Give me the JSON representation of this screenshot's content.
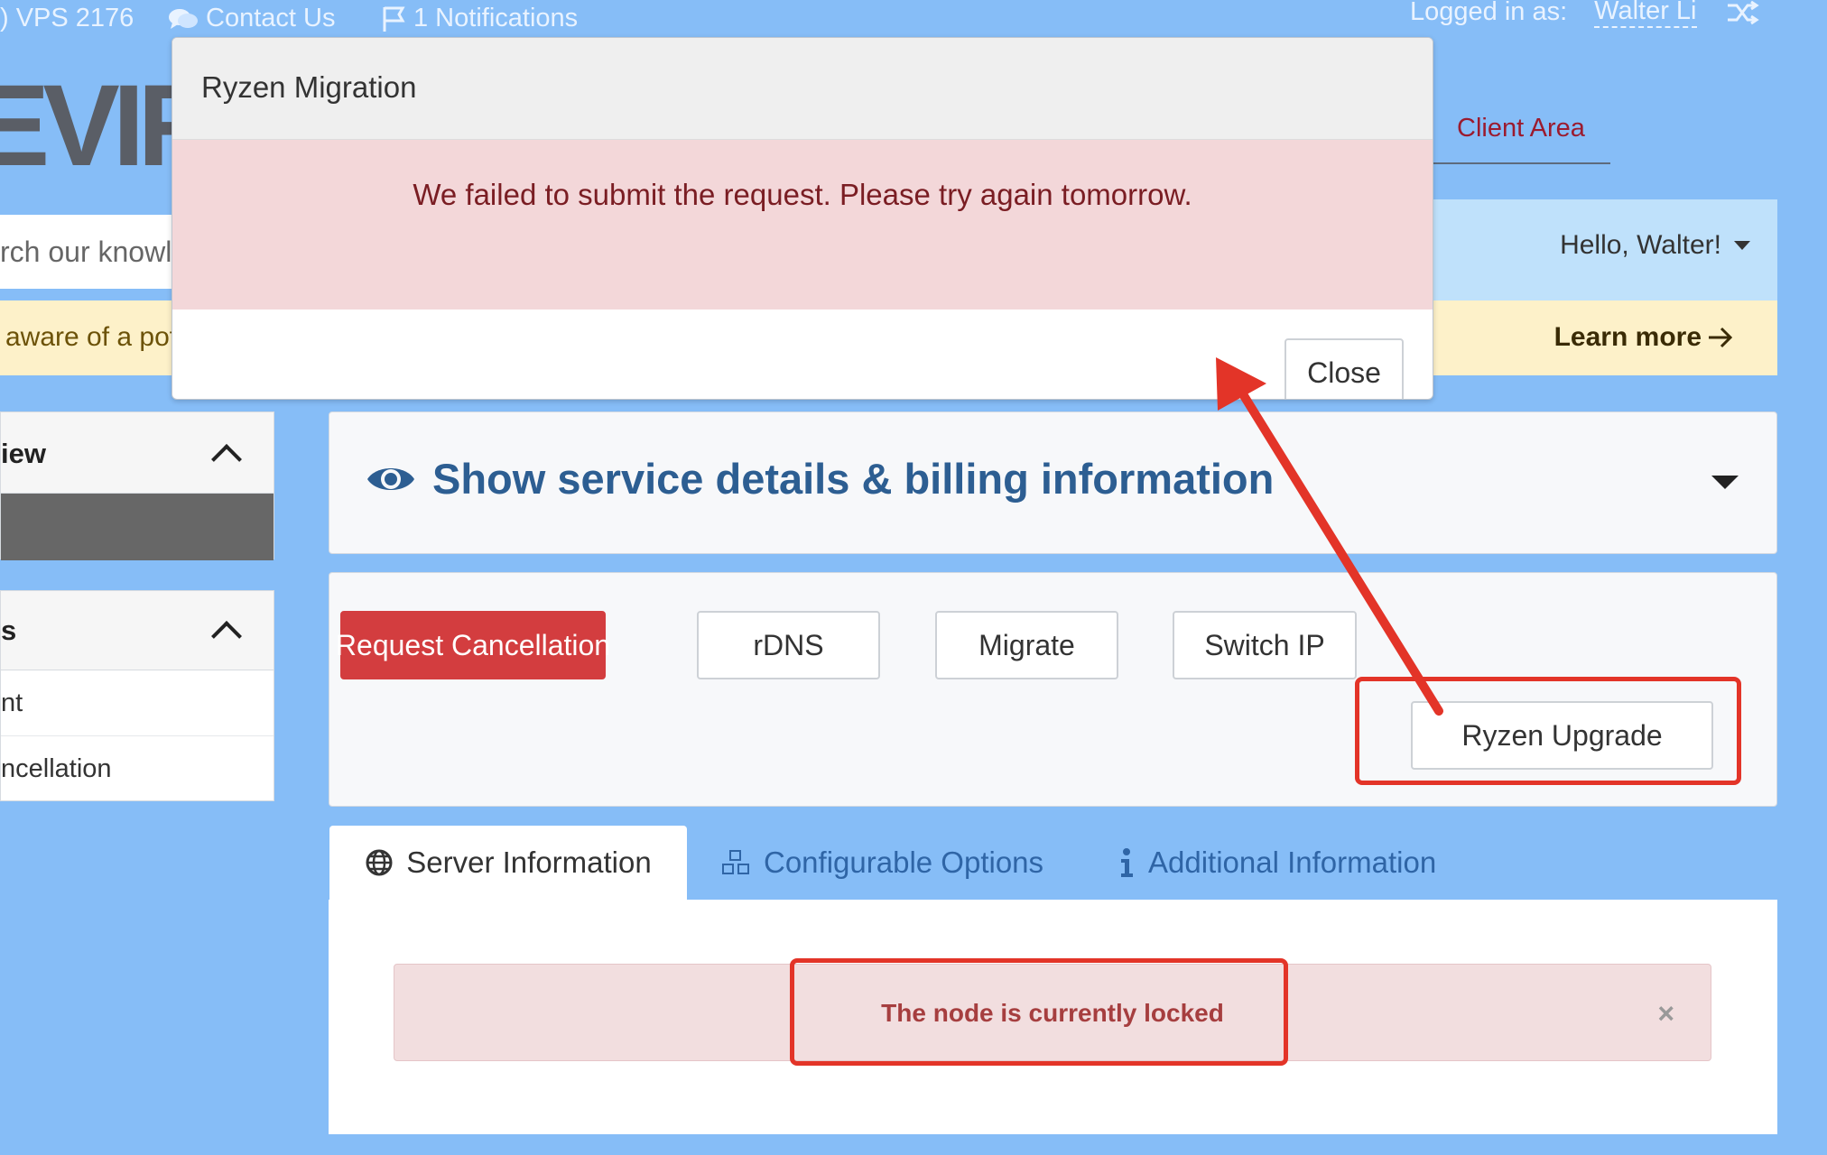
{
  "topbar": {
    "vps_label": ") VPS 2176",
    "contact_label": "Contact Us",
    "notifications_label": "1 Notifications",
    "logged_in_label": "Logged in as:",
    "user_name": "Walter Li"
  },
  "logo": {
    "text": "EVIRM"
  },
  "nav": {
    "client_area": "Client Area"
  },
  "search": {
    "placeholder": "rch our knowl"
  },
  "greeting": {
    "text": "Hello, Walter!"
  },
  "notice": {
    "text": "aware of a pot",
    "learn_more": "Learn more"
  },
  "sidebar": {
    "panel1_title": "iew",
    "panel2_title": "s",
    "panel2_items": [
      "nt",
      "ncellation"
    ]
  },
  "service_panel": {
    "title": "Show service details & billing information"
  },
  "actions": {
    "request_cancellation": "Request Cancellation",
    "rdns": "rDNS",
    "migrate": "Migrate",
    "switch_ip": "Switch IP",
    "ryzen_upgrade": "Ryzen Upgrade"
  },
  "tabs": {
    "server_information": "Server Information",
    "configurable_options": "Configurable Options",
    "additional_information": "Additional Information"
  },
  "alert": {
    "text": "The node is currently locked",
    "close": "×"
  },
  "modal": {
    "title": "Ryzen Migration",
    "error_text": "We failed to submit the request. Please try again tomorrow.",
    "close_label": "Close"
  },
  "colors": {
    "page_bg": "#86bdf7",
    "danger": "#d33d3f",
    "annotation_red": "#e33428",
    "link_blue": "#2f65a6",
    "title_blue": "#2d5e92"
  }
}
